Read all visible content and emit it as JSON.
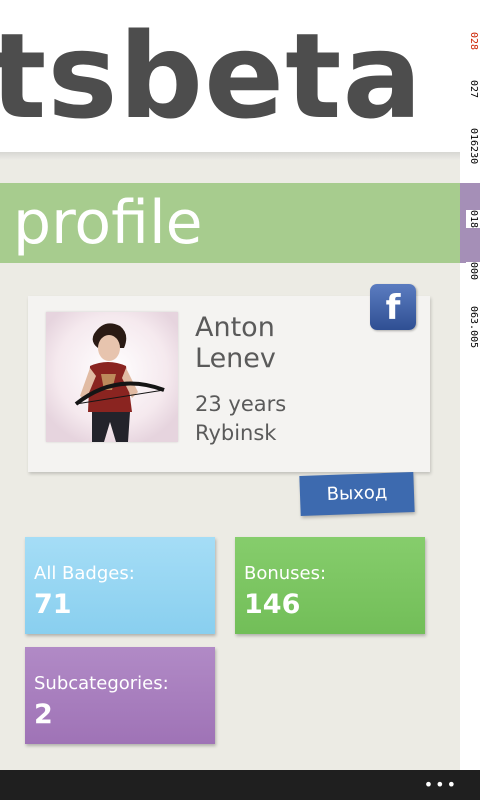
{
  "app": {
    "title": "tsbeta"
  },
  "page": {
    "title": "profile"
  },
  "profile": {
    "first_name": "Anton",
    "last_name": "Lenev",
    "age": "23 years",
    "city": "Rybinsk",
    "facebook_glyph": "f",
    "logout_label": "Выход"
  },
  "tiles": [
    {
      "label": "All Badges:",
      "value": "71",
      "color": "#9fd9f4"
    },
    {
      "label": "Bonuses:",
      "value": "146",
      "color": "#7dc663"
    },
    {
      "label": "Subcategories:",
      "value": "2",
      "color": "#ad85c3"
    }
  ],
  "counters": [
    "028",
    "027",
    "016230",
    "018",
    "000",
    "063.005"
  ],
  "appbar": {
    "more_label": "•••"
  },
  "colors": {
    "accent_green": "#a7cc8e",
    "facebook_blue": "#3b5998",
    "logout_blue": "#3d6aaf"
  }
}
